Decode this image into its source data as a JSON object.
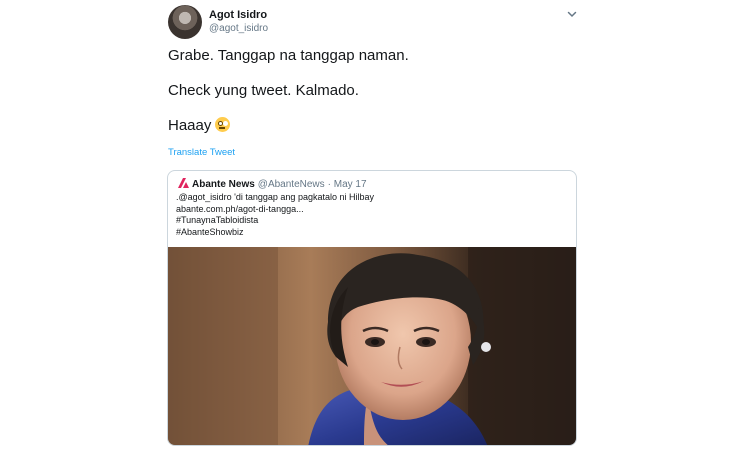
{
  "tweet": {
    "author_name": "Agot Isidro",
    "author_handle": "@agot_isidro",
    "lines": [
      "Grabe. Tanggap na tanggap naman.",
      "Check yung tweet. Kalmado.",
      "Haaay"
    ],
    "emoji": "face-with-rolling-eyes-icon",
    "translate_label": "Translate Tweet"
  },
  "quoted": {
    "author_name": "Abante News",
    "author_handle": "@AbanteNews",
    "date": "· May 17",
    "lines": [
      ".@agot_isidro 'di tanggap ang pagkatalo ni Hilbay",
      "abante.com.ph/agot-di-tangga...",
      "#TunaynaTabloidista",
      "#AbanteShowbiz"
    ],
    "logo_color": "#e0245e"
  },
  "colors": {
    "link": "#1da1f2",
    "secondary": "#657786",
    "border": "#ccd6dd"
  }
}
